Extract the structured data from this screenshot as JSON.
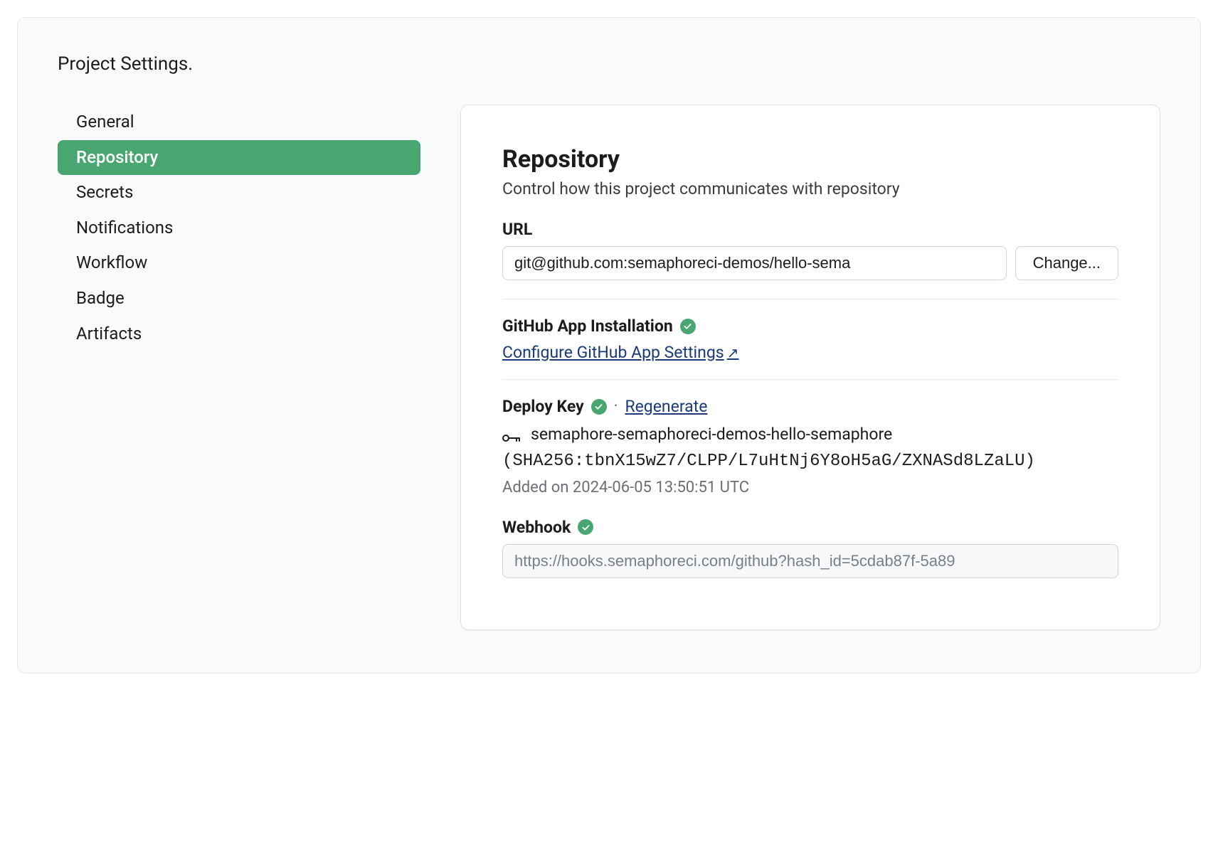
{
  "page": {
    "title": "Project Settings."
  },
  "sidebar": {
    "items": [
      {
        "label": "General",
        "active": false
      },
      {
        "label": "Repository",
        "active": true
      },
      {
        "label": "Secrets",
        "active": false
      },
      {
        "label": "Notifications",
        "active": false
      },
      {
        "label": "Workflow",
        "active": false
      },
      {
        "label": "Badge",
        "active": false
      },
      {
        "label": "Artifacts",
        "active": false
      }
    ]
  },
  "panel": {
    "heading": "Repository",
    "subtitle": "Control how this project communicates with repository",
    "url": {
      "label": "URL",
      "value": "git@github.com:semaphoreci-demos/hello-sema",
      "change_label": "Change..."
    },
    "github_app": {
      "label": "GitHub App Installation",
      "link_label": "Configure GitHub App Settings",
      "external_arrow": "↗"
    },
    "deploy_key": {
      "label": "Deploy Key",
      "regenerate_label": "Regenerate",
      "separator": "·",
      "key_name": "semaphore-semaphoreci-demos-hello-semaphore",
      "fingerprint": "(SHA256:tbnX15wZ7/CLPP/L7uHtNj6Y8oH5aG/ZXNASd8LZaLU)",
      "added_note": "Added on 2024-06-05 13:50:51 UTC"
    },
    "webhook": {
      "label": "Webhook",
      "value": "https://hooks.semaphoreci.com/github?hash_id=5cdab87f-5a89"
    }
  }
}
